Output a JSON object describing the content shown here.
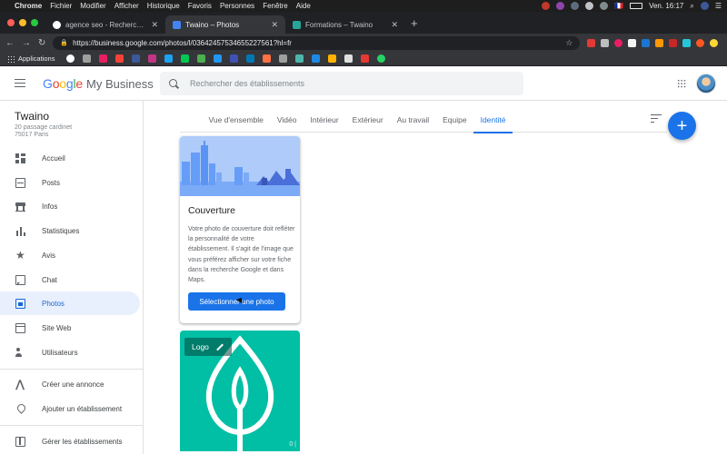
{
  "menubar": {
    "items": [
      "Chrome",
      "Fichier",
      "Modifier",
      "Afficher",
      "Historique",
      "Favoris",
      "Personnes",
      "Fenêtre",
      "Aide"
    ],
    "clock": "Ven. 16:17",
    "flag": "🇫🇷"
  },
  "browser": {
    "tabs": [
      {
        "title": "agence seo - Recherche Google",
        "favicon_color": "#ffffff"
      },
      {
        "title": "Twaino – Photos",
        "favicon_color": "#4285f4"
      },
      {
        "title": "Formations – Twaino",
        "favicon_color": "#26a69a"
      }
    ],
    "url": "https://business.google.com/photos/l/03642457534655227561?hl=fr",
    "bookmarks_label": "Applications"
  },
  "header": {
    "logo_google": "Google",
    "logo_product": "My Business",
    "search_placeholder": "Rechercher des établissements"
  },
  "business": {
    "name": "Twaino",
    "address_line1": "20 passage cardinet",
    "address_line2": "75017 Paris"
  },
  "nav": {
    "items": [
      {
        "label": "Accueil",
        "icon": "dashboard-icon"
      },
      {
        "label": "Posts",
        "icon": "posts-icon"
      },
      {
        "label": "Infos",
        "icon": "store-icon"
      },
      {
        "label": "Statistiques",
        "icon": "bar-chart-icon"
      },
      {
        "label": "Avis",
        "icon": "star-icon"
      },
      {
        "label": "Chat",
        "icon": "chat-icon"
      },
      {
        "label": "Photos",
        "icon": "photo-library-icon",
        "active": true
      },
      {
        "label": "Site Web",
        "icon": "web-icon"
      },
      {
        "label": "Utilisateurs",
        "icon": "person-add-icon"
      }
    ],
    "secondary": [
      {
        "label": "Créer une annonce",
        "icon": "google-ads-icon"
      },
      {
        "label": "Ajouter un établissement",
        "icon": "add-location-icon"
      }
    ],
    "tertiary": [
      {
        "label": "Gérer les établissements",
        "icon": "manage-locations-icon"
      }
    ]
  },
  "photo_tabs": {
    "items": [
      "Vue d'ensemble",
      "Vidéo",
      "Intérieur",
      "Extérieur",
      "Au travail",
      "Equipe",
      "Identité"
    ],
    "active": "Identité"
  },
  "cover_card": {
    "title": "Couverture",
    "description": "Votre photo de couverture doit refléter la personnalité de votre établissement. Il s'agit de l'image que vous préférez afficher sur votre fiche dans la recherche Google et dans Maps.",
    "button": "Sélectionner une photo"
  },
  "logo_card": {
    "label": "Logo",
    "count": "0 |"
  },
  "colors": {
    "accent": "#1a73e8",
    "logo_bg": "#00bfa5",
    "nav_active_bg": "#e8f0fe"
  }
}
